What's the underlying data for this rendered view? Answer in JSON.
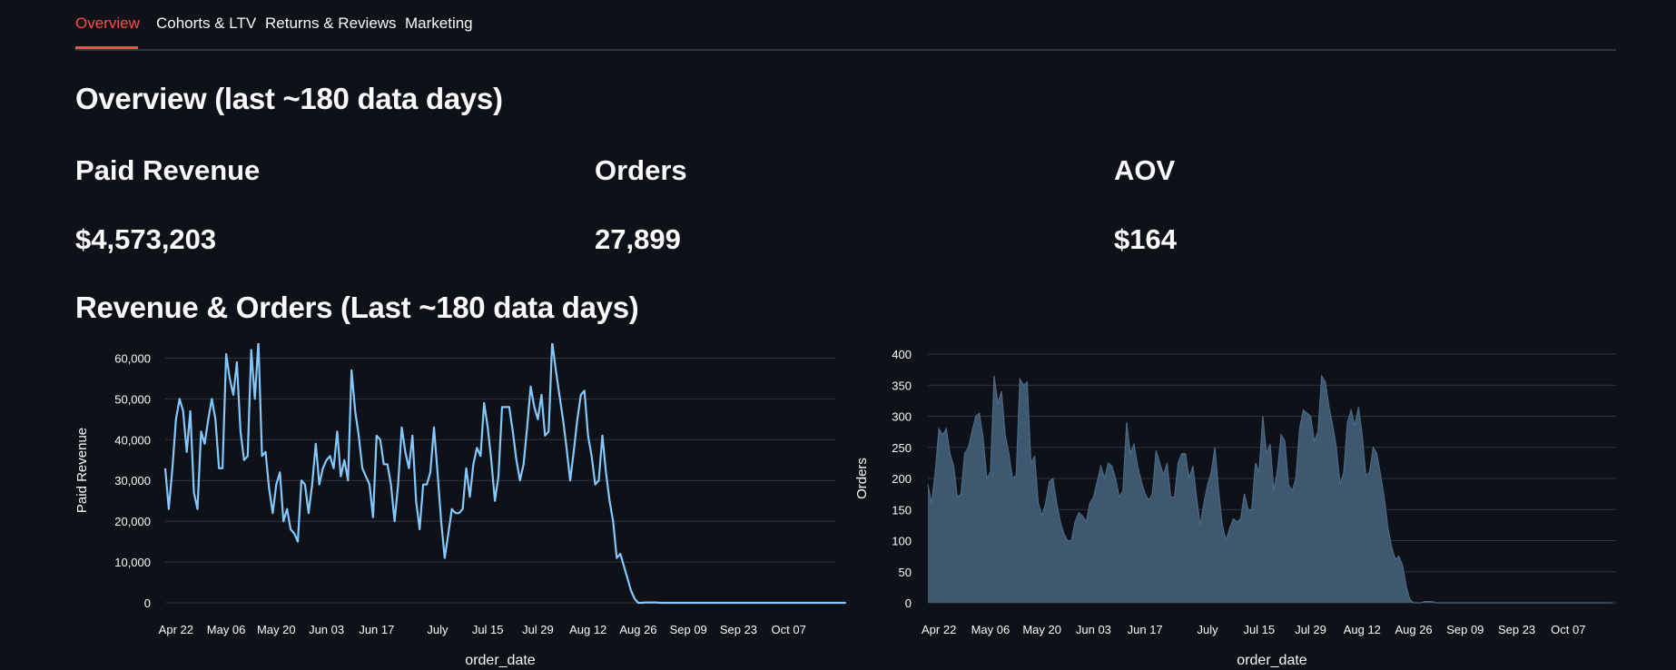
{
  "tabs": [
    {
      "label": "Overview",
      "active": true
    },
    {
      "label": "Cohorts & LTV",
      "active": false
    },
    {
      "label": "Returns & Reviews",
      "active": false
    },
    {
      "label": "Marketing",
      "active": false
    }
  ],
  "page": {
    "title": "Overview (last ~180 data days)",
    "section_title": "Revenue & Orders (Last ~180 data days)"
  },
  "metrics": [
    {
      "label": "Paid Revenue",
      "value": "$4,573,203"
    },
    {
      "label": "Orders",
      "value": "27,899"
    },
    {
      "label": "AOV",
      "value": "$164"
    }
  ],
  "colors": {
    "accent": "#ff4b4b",
    "background": "#0e1117",
    "line": "#83c9ff",
    "area_fill": "#3e5870",
    "area_stroke": "#4a6a86"
  },
  "chart_data": [
    {
      "type": "line",
      "xlabel": "order_date",
      "ylabel": "Paid Revenue",
      "ylim": [
        0,
        65000
      ],
      "yticks": [
        0,
        10000,
        20000,
        30000,
        40000,
        50000,
        60000
      ],
      "ytick_labels": [
        "0",
        "10,000",
        "20,000",
        "30,000",
        "40,000",
        "50,000",
        "60,000"
      ],
      "xtick_labels": [
        "Apr 22",
        "May 06",
        "May 20",
        "Jun 03",
        "Jun 17",
        "July",
        "Jul 15",
        "Jul 29",
        "Aug 12",
        "Aug 26",
        "Sep 09",
        "Sep 23",
        "Oct 07"
      ],
      "x_start": "2024-04-19",
      "days": 188,
      "grid": true,
      "values": [
        33000,
        23000,
        33000,
        45000,
        50000,
        47000,
        37000,
        47000,
        27000,
        23000,
        42000,
        39000,
        45000,
        50000,
        45000,
        33000,
        33000,
        61000,
        55000,
        51000,
        59000,
        42000,
        35000,
        36000,
        62000,
        50000,
        64000,
        36000,
        37000,
        28000,
        22000,
        29000,
        32000,
        20000,
        23000,
        18000,
        17000,
        15000,
        30000,
        29000,
        22000,
        29000,
        39000,
        29000,
        33000,
        35000,
        36000,
        33000,
        42000,
        31000,
        35000,
        30000,
        57000,
        47000,
        41000,
        33000,
        31000,
        29000,
        21000,
        41000,
        40000,
        34000,
        34000,
        29000,
        20000,
        29000,
        43000,
        37000,
        33000,
        41000,
        25000,
        18000,
        29000,
        29000,
        32000,
        43000,
        32000,
        20000,
        11000,
        17000,
        23000,
        22000,
        22000,
        23000,
        33000,
        26000,
        34000,
        38000,
        36000,
        49000,
        43000,
        35000,
        25000,
        31000,
        48000,
        48000,
        48000,
        42000,
        35000,
        30000,
        34000,
        43000,
        53000,
        48000,
        45000,
        51000,
        41000,
        42000,
        64000,
        57000,
        51000,
        45000,
        38000,
        30000,
        37000,
        45000,
        51000,
        52000,
        41000,
        36000,
        29000,
        30000,
        41000,
        32000,
        25000,
        20000,
        11000,
        12000,
        9000,
        6000,
        3000,
        1000,
        0,
        0,
        100,
        100,
        100,
        100,
        0,
        0,
        0,
        0,
        0,
        0,
        0,
        0,
        0,
        0,
        0,
        0,
        0,
        0,
        0,
        0,
        0,
        0,
        0,
        0,
        0,
        0,
        0,
        0,
        0,
        0,
        0,
        0,
        0,
        0,
        0,
        0,
        0,
        0,
        0,
        0,
        0,
        0,
        0,
        0,
        0,
        0,
        0,
        0,
        0,
        0,
        0,
        0,
        0,
        0,
        0,
        0,
        0
      ]
    },
    {
      "type": "area",
      "xlabel": "order_date",
      "ylabel": "Orders",
      "ylim": [
        0,
        400
      ],
      "yticks": [
        0,
        50,
        100,
        150,
        200,
        250,
        300,
        350,
        400
      ],
      "ytick_labels": [
        "0",
        "50",
        "100",
        "150",
        "200",
        "250",
        "300",
        "350",
        "400"
      ],
      "xtick_labels": [
        "Apr 22",
        "May 06",
        "May 20",
        "Jun 03",
        "Jun 17",
        "July",
        "Jul 15",
        "Jul 29",
        "Aug 12",
        "Aug 26",
        "Sep 09",
        "Sep 23",
        "Oct 07"
      ],
      "x_start": "2024-04-19",
      "days": 188,
      "grid": true,
      "values": [
        190,
        160,
        210,
        280,
        270,
        280,
        240,
        220,
        170,
        175,
        240,
        250,
        275,
        300,
        305,
        265,
        200,
        210,
        365,
        320,
        340,
        270,
        240,
        200,
        205,
        360,
        350,
        355,
        225,
        235,
        160,
        140,
        160,
        195,
        200,
        160,
        130,
        110,
        100,
        100,
        130,
        145,
        140,
        130,
        160,
        170,
        195,
        220,
        200,
        225,
        220,
        200,
        170,
        180,
        290,
        240,
        255,
        220,
        195,
        175,
        165,
        175,
        245,
        225,
        205,
        225,
        170,
        170,
        225,
        240,
        240,
        200,
        220,
        170,
        125,
        160,
        190,
        210,
        250,
        180,
        125,
        100,
        120,
        135,
        130,
        135,
        175,
        150,
        150,
        225,
        210,
        300,
        240,
        255,
        180,
        215,
        270,
        260,
        190,
        180,
        200,
        280,
        310,
        305,
        300,
        260,
        275,
        365,
        355,
        315,
        285,
        250,
        190,
        210,
        290,
        310,
        285,
        315,
        270,
        205,
        210,
        250,
        240,
        205,
        170,
        120,
        90,
        70,
        75,
        60,
        25,
        5,
        0,
        0,
        0,
        2,
        2,
        2,
        0,
        0,
        0,
        0,
        0,
        0,
        0,
        0,
        0,
        0,
        0,
        0,
        0,
        0,
        0,
        0,
        0,
        0,
        0,
        0,
        0,
        0,
        0,
        0,
        0,
        0,
        0,
        0,
        0,
        0,
        0,
        0,
        0,
        0,
        0,
        0,
        0,
        0,
        0,
        0,
        0,
        0,
        0,
        0,
        0,
        0,
        0,
        0,
        0
      ]
    }
  ]
}
